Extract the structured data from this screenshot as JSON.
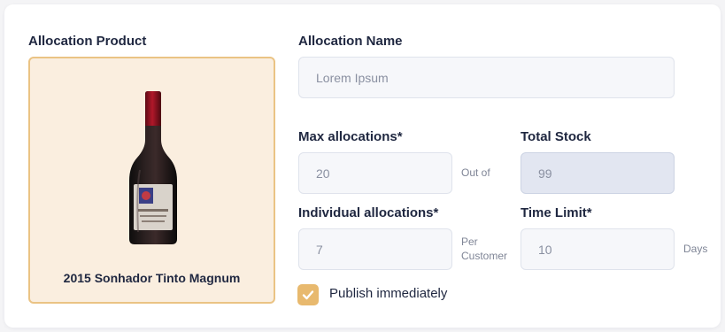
{
  "product": {
    "section_label": "Allocation Product",
    "name": "2015 Sonhador Tinto Magnum",
    "image_icon": "wine-bottle-icon"
  },
  "allocation_name": {
    "label": "Allocation Name",
    "placeholder": "Lorem Ipsum"
  },
  "max_allocations": {
    "label": "Max allocations*",
    "value": "20",
    "suffix": "Out of"
  },
  "total_stock": {
    "label": "Total Stock",
    "value": "99"
  },
  "individual_allocations": {
    "label": "Individual allocations*",
    "value": "7",
    "suffix_line1": "Per",
    "suffix_line2": "Customer"
  },
  "time_limit": {
    "label": "Time Limit*",
    "value": "10",
    "suffix": "Days"
  },
  "publish": {
    "label": "Publish immediately",
    "checked": true,
    "icon": "check-icon"
  },
  "colors": {
    "accent": "#e8b96e",
    "product_bg": "#faeedf",
    "product_border": "#eac384",
    "heading_text": "#1f2740"
  }
}
